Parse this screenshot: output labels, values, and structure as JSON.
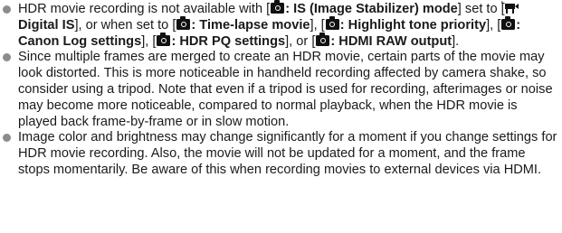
{
  "notes": [
    {
      "t1": "HDR movie recording is not available with [",
      "is_label": ": IS (Image Stabilizer) mode",
      "t2": "] set to [",
      "digital_is": "Digital IS",
      "t3": "], or when set to [",
      "timelapse": ": Time-lapse movie",
      "t4": "], [",
      "highlight": ": Highlight tone priority",
      "t5": "], [",
      "canonlog": ": Canon Log settings",
      "t6": "], [",
      "hdrpq": ": HDR PQ settings",
      "t7": "], or [",
      "hdmiraw": ": HDMI RAW output",
      "t8": "]."
    },
    {
      "text": "Since multiple frames are merged to create an HDR movie, certain parts of the movie may look distorted. This is more noticeable in handheld recording affected by camera shake, so consider using a tripod. Note that even if a tripod is used for recording, afterimages or noise may become more noticeable, compared to normal playback, when the HDR movie is played back frame-by-frame or in slow motion."
    },
    {
      "text": "Image color and brightness may change significantly for a moment if you change settings for HDR movie recording. Also, the movie will not be updated for a moment, and the frame stops momentarily. Be aware of this when recording movies to external devices via HDMI."
    }
  ],
  "icons": {
    "camera": "camera-icon",
    "movie_camera": "movie-camera-icon",
    "bullet": "bullet-icon"
  },
  "colors": {
    "text": "#1a1a1a",
    "bullet": "#8c8c8c",
    "icon": "#111111"
  }
}
